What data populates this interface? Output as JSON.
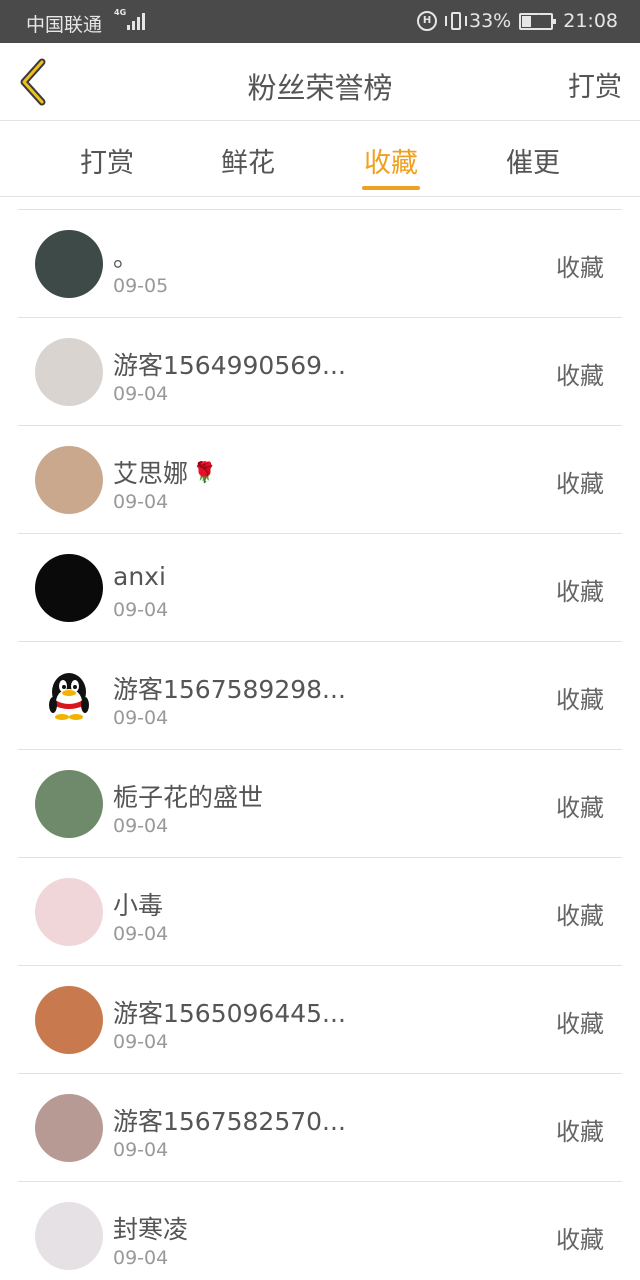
{
  "status_bar": {
    "carrier": "中国联通",
    "network": "4G",
    "battery_percent": "33%",
    "time": "21:08"
  },
  "header": {
    "title": "粉丝荣誉榜",
    "right_action": "打赏",
    "back_icon": "chevron-left-icon"
  },
  "tabs": [
    {
      "label": "打赏",
      "active": false
    },
    {
      "label": "鲜花",
      "active": false
    },
    {
      "label": "收藏",
      "active": true
    },
    {
      "label": "催更",
      "active": false
    }
  ],
  "colors": {
    "accent": "#f0a020",
    "status_bar_bg": "#4a4a4a",
    "text": "#555555",
    "divider": "#e3e3e3"
  },
  "list": [
    {
      "name": "。",
      "date": "09-05",
      "action": "收藏",
      "avatar_color": "#3d4a48"
    },
    {
      "name": "游客1564990569...",
      "date": "09-04",
      "action": "收藏",
      "avatar_color": "#d9d4cf"
    },
    {
      "name": "艾思娜",
      "date": "09-04",
      "action": "收藏",
      "avatar_color": "#c9a88e",
      "emoji": "🌹"
    },
    {
      "name": "anxi",
      "date": "09-04",
      "action": "收藏",
      "avatar_color": "#0a0a0a"
    },
    {
      "name": "游客1567589298...",
      "date": "09-04",
      "action": "收藏",
      "avatar_color": "#ffffff",
      "avatar_icon": "penguin-icon"
    },
    {
      "name": "栀子花的盛世",
      "date": "09-04",
      "action": "收藏",
      "avatar_color": "#6f8a6a"
    },
    {
      "name": "小毒",
      "date": "09-04",
      "action": "收藏",
      "avatar_color": "#f0d6d9"
    },
    {
      "name": "游客1565096445...",
      "date": "09-04",
      "action": "收藏",
      "avatar_color": "#c87a4e"
    },
    {
      "name": "游客1567582570...",
      "date": "09-04",
      "action": "收藏",
      "avatar_color": "#b89a94"
    },
    {
      "name": "封寒凌",
      "date": "09-04",
      "action": "收藏",
      "avatar_color": "#e6e1e4"
    }
  ]
}
